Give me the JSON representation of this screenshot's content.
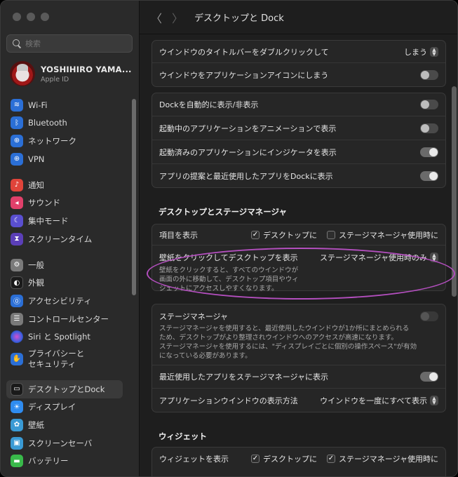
{
  "search": {
    "placeholder": "検索"
  },
  "user": {
    "name": "YOSHIHIRO YAMA...",
    "subtitle": "Apple ID"
  },
  "sidebar": {
    "items": [
      {
        "key": "wifi",
        "label": "Wi-Fi",
        "icon": "wifi-icon"
      },
      {
        "key": "bluetooth",
        "label": "Bluetooth",
        "icon": "bluetooth-icon"
      },
      {
        "key": "network",
        "label": "ネットワーク",
        "icon": "globe-icon"
      },
      {
        "key": "vpn",
        "label": "VPN",
        "icon": "vpn-globe-icon"
      },
      {
        "key": "notifications",
        "label": "通知",
        "icon": "bell-icon"
      },
      {
        "key": "sound",
        "label": "サウンド",
        "icon": "speaker-icon"
      },
      {
        "key": "focus",
        "label": "集中モード",
        "icon": "moon-icon"
      },
      {
        "key": "screentime",
        "label": "スクリーンタイム",
        "icon": "hourglass-icon"
      },
      {
        "key": "general",
        "label": "一般",
        "icon": "gear-icon"
      },
      {
        "key": "appearance",
        "label": "外観",
        "icon": "appearance-icon"
      },
      {
        "key": "accessibility",
        "label": "アクセシビリティ",
        "icon": "accessibility-icon"
      },
      {
        "key": "controlcenter",
        "label": "コントロールセンター",
        "icon": "control-center-icon"
      },
      {
        "key": "siri",
        "label": "Siri と Spotlight",
        "icon": "siri-icon"
      },
      {
        "key": "privacy",
        "label": "プライバシーと\nセキュリティ",
        "icon": "hand-icon"
      },
      {
        "key": "desktopdock",
        "label": "デスクトップとDock",
        "icon": "dock-icon"
      },
      {
        "key": "displays",
        "label": "ディスプレイ",
        "icon": "sun-icon"
      },
      {
        "key": "wallpaper",
        "label": "壁紙",
        "icon": "flower-icon"
      },
      {
        "key": "screensaver",
        "label": "スクリーンセーバ",
        "icon": "screensaver-icon"
      },
      {
        "key": "battery",
        "label": "バッテリー",
        "icon": "battery-icon"
      }
    ],
    "selected": "desktopdock"
  },
  "toolbar": {
    "title": "デスクトップと Dock"
  },
  "window_actions": {
    "titlebar_dblclick": {
      "label": "ウインドウのタイトルバーをダブルクリックして",
      "value": "しまう"
    },
    "minimize_into_icon": {
      "label": "ウインドウをアプリケーションアイコンにしまう",
      "on": false
    }
  },
  "dock": {
    "autohide": {
      "label": "Dockを自動的に表示/非表示",
      "on": false
    },
    "animate": {
      "label": "起動中のアプリケーションをアニメーションで表示",
      "on": false
    },
    "indicators": {
      "label": "起動済みのアプリケーションにインジケータを表示",
      "on": true
    },
    "recents": {
      "label": "アプリの提案と最近使用したアプリをDockに表示",
      "on": true
    }
  },
  "desktop_stage": {
    "section_title": "デスクトップとステージマネージャ",
    "show_items": {
      "label": "項目を表示",
      "desktop": {
        "label": "デスクトップに",
        "checked": true
      },
      "stage": {
        "label": "ステージマネージャ使用時に",
        "checked": false
      }
    },
    "click_wallpaper": {
      "label": "壁紙をクリックしてデスクトップを表示",
      "value": "ステージマネージャ使用時のみ",
      "desc1": "壁紙をクリックすると、すべてのウインドウが",
      "desc2": "画面の外に移動して、デスクトップ項目やウィ",
      "desc3": "ジェットにアクセスしやすくなります。"
    }
  },
  "stage_manager": {
    "label": "ステージマネージャ",
    "on": false,
    "desc1": "ステージマネージャを使用すると、最近使用したウインドウが1か所にまとめられる",
    "desc2": "ため、デスクトップがより整理されウインドウへのアクセスが高速になります。",
    "desc3": "ステージマネージャを使用するには、\"ディスプレイごとに個別の操作スペース\"が有効",
    "desc4": "になっている必要があります。",
    "recent_apps": {
      "label": "最近使用したアプリをステージマネージャに表示",
      "on": true
    },
    "show_windows": {
      "label": "アプリケーションウインドウの表示方法",
      "value": "ウインドウを一度にすべて表示"
    }
  },
  "widgets": {
    "section_title": "ウィジェット",
    "show": {
      "label": "ウィジェットを表示",
      "desktop": {
        "label": "デスクトップに",
        "checked": true
      },
      "stage": {
        "label": "ステージマネージャ使用時に",
        "checked": true
      }
    }
  },
  "colors": {
    "annotation": "#b44fbf",
    "selected_bg": "#3a3a3a"
  }
}
